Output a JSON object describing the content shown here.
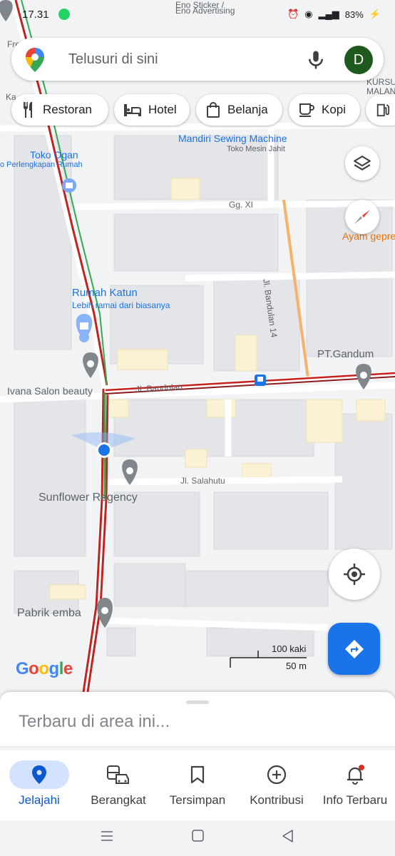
{
  "status_bar": {
    "time": "17.31",
    "battery": "83%"
  },
  "search": {
    "placeholder": "Telusuri di sini",
    "avatar_letter": "D"
  },
  "chips": [
    {
      "label": "Restoran",
      "icon": "fork-knife-icon"
    },
    {
      "label": "Hotel",
      "icon": "bed-icon"
    },
    {
      "label": "Belanja",
      "icon": "shopping-bag-icon"
    },
    {
      "label": "Kopi",
      "icon": "coffee-cup-icon"
    }
  ],
  "map": {
    "labels": {
      "eno_sticker": "Eno Sticker /",
      "eno_advertising": "Eno Advertising",
      "kursus": "KURSUS",
      "malan": "MALAN",
      "fre": "Fre",
      "ka": "Ka",
      "mandiri": "Mandiri Sewing Machine",
      "toko_mesin": "Toko Mesin Jahit",
      "toko_ogan": "Toko Ogan",
      "perlengkapan": "o Perlengkapan Rumah",
      "gg_xi": "Gg. XI",
      "ayam": "Ayam gepre",
      "jl_bandulan_14": "Jl. Bandulan 14",
      "rumah_katun": "Rumah Katun",
      "lebih_ramai": "Lebih ramai dari biasanya",
      "pt_gandum": "PT.Gandum",
      "ivana": "Ivana Salon beauty",
      "jl_bandulan": "Jl. Bandulan",
      "jl_salahutu": "Jl. Salahutu",
      "sunflower": "Sunflower Regency",
      "pabrik": "Pabrik emba",
      "scale_kaki": "100 kaki",
      "scale_m": "50 m",
      "google": "Google"
    }
  },
  "bottom_sheet": {
    "text": "Terbaru di area ini..."
  },
  "bottom_nav": [
    {
      "label": "Jelajahi",
      "icon": "explore-pin-icon",
      "active": true
    },
    {
      "label": "Berangkat",
      "icon": "commute-icon",
      "active": false
    },
    {
      "label": "Tersimpan",
      "icon": "bookmark-icon",
      "active": false
    },
    {
      "label": "Kontribusi",
      "icon": "add-circle-icon",
      "active": false
    },
    {
      "label": "Info Terbaru",
      "icon": "bell-icon",
      "active": false
    }
  ],
  "colors": {
    "accent": "#1a73e8",
    "traffic_red": "#c5221f",
    "traffic_green": "#34a853",
    "road_orange": "#f29900"
  }
}
